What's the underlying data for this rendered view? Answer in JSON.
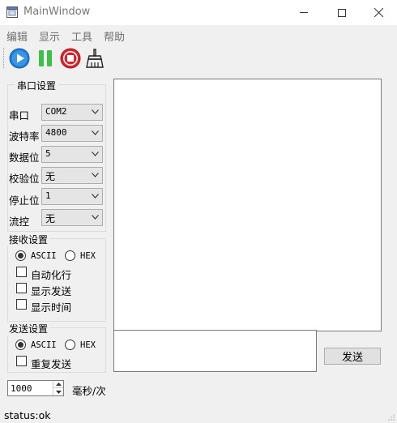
{
  "window": {
    "title": "MainWindow",
    "minimize": "—",
    "maximize": "☐",
    "close": "✕"
  },
  "menu": [
    "编辑",
    "显示",
    "工具",
    "帮助"
  ],
  "toolbar": [
    "play",
    "pause",
    "stop",
    "clear"
  ],
  "serial": {
    "group_title": "串口设置",
    "rows": [
      {
        "label": "串口",
        "value": "COM2"
      },
      {
        "label": "波特率",
        "value": "4800"
      },
      {
        "label": "数据位",
        "value": "5"
      },
      {
        "label": "校验位",
        "value": "无"
      },
      {
        "label": "停止位",
        "value": "1"
      },
      {
        "label": "流控",
        "value": "无"
      }
    ]
  },
  "receive": {
    "group_title": "接收设置",
    "ascii": "ASCII",
    "hex": "HEX",
    "auto_wrap": "自动化行",
    "show_send": "显示发送",
    "show_time": "显示时间"
  },
  "send_settings": {
    "group_title": "发送设置",
    "ascii": "ASCII",
    "hex": "HEX",
    "repeat": "重复发送"
  },
  "interval": {
    "value": "1000",
    "unit": "毫秒/次"
  },
  "send_button": "发送",
  "status": "status:ok",
  "colors": {
    "play": "#1e7fd6",
    "pause": "#3dbf4a",
    "stop": "#d7262d"
  }
}
